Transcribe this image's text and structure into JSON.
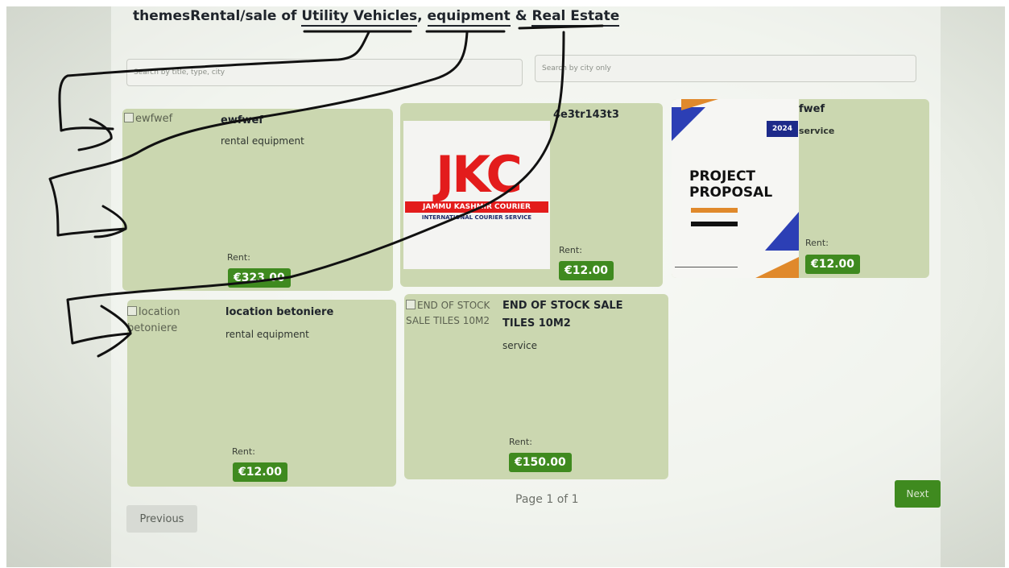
{
  "header": {
    "title_prefix": "themesRental/sale of ",
    "title_part1": "Utility Vehicles",
    "title_sep1": ", ",
    "title_part2": "equipment",
    "title_sep2": " & ",
    "title_part3": "Real Estate"
  },
  "search": {
    "main_placeholder": "Search by title, type, city",
    "city_placeholder": "Search by city only"
  },
  "listings": [
    {
      "image_alt": "ewfwef",
      "name": "ewfwef",
      "type": "rental equipment",
      "rent_label": "Rent:",
      "price": "€323.00"
    },
    {
      "name": "4e3tr143t3",
      "type": "",
      "rent_label": "Rent:",
      "price": "€12.00",
      "image_text": {
        "logo": "JKC",
        "band": "JAMMU KASHMIR COURIER",
        "sub": "INTERNATIONAL COURIER SERVICE"
      }
    },
    {
      "name": "fwef",
      "type": "service",
      "rent_label": "Rent:",
      "price": "€12.00",
      "image_text": {
        "year": "2024",
        "title_line1": "PROJECT",
        "title_line2": "PROPOSAL"
      }
    },
    {
      "image_alt": "location betoniere",
      "name": "location betoniere",
      "type": "rental equipment",
      "rent_label": "Rent:",
      "price": "€12.00"
    },
    {
      "image_alt": "END OF STOCK SALE TILES 10M2",
      "name": "END OF STOCK SALE TILES 10M2",
      "type": "service",
      "rent_label": "Rent:",
      "price": "€150.00"
    }
  ],
  "pagination": {
    "text": "Page 1 of 1",
    "previous_label": "Previous",
    "next_label": "Next"
  },
  "colors": {
    "card_bg": "#cbd7b0",
    "accent_green": "#3f8a1f",
    "ink": "#111111"
  }
}
